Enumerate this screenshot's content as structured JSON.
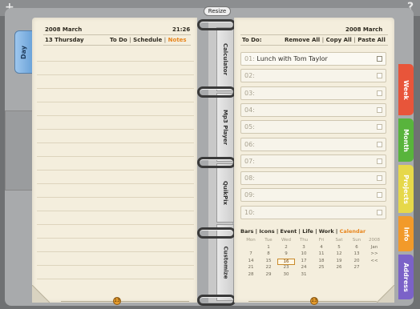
{
  "window": {
    "add_glyph": "+",
    "help_glyph": "?",
    "resize_label": "Resize"
  },
  "left_tab": {
    "label": "Day"
  },
  "left_page": {
    "year_month": "2008 March",
    "time": "21:26",
    "day": "13 Thursday",
    "tabs": [
      "To Do",
      "Schedule",
      "Notes"
    ],
    "active_tab": "Notes",
    "page_number": "13"
  },
  "spine_tabs": [
    "Calculator",
    "Mp3 Player",
    "QuikPix",
    "Customize"
  ],
  "right_page": {
    "year_month": "2008 March",
    "todo_label": "To Do:",
    "actions": [
      "Remove All",
      "Copy All",
      "Paste All"
    ],
    "page_number": "13",
    "todos": [
      {
        "num": "01:",
        "text": "Lunch with Tom Taylor"
      },
      {
        "num": "02:",
        "text": ""
      },
      {
        "num": "03:",
        "text": ""
      },
      {
        "num": "04:",
        "text": ""
      },
      {
        "num": "05:",
        "text": ""
      },
      {
        "num": "06:",
        "text": ""
      },
      {
        "num": "07:",
        "text": ""
      },
      {
        "num": "08:",
        "text": ""
      },
      {
        "num": "09:",
        "text": ""
      },
      {
        "num": "10:",
        "text": ""
      }
    ]
  },
  "calendar": {
    "views": [
      "Bars",
      "Icons",
      "Event",
      "Life",
      "Work",
      "Calendar"
    ],
    "active_view": "Calendar",
    "weekdays": [
      "Mon",
      "Tue",
      "Wed",
      "Thu",
      "Fri",
      "Sat",
      "Sun"
    ],
    "year": "2008",
    "month_abbr": "Jan",
    "next_glyph": ">>",
    "prev_glyph": "<<",
    "weeks": [
      [
        "",
        "1",
        "2",
        "3",
        "4",
        "5",
        "6"
      ],
      [
        "7",
        "8",
        "9",
        "10",
        "11",
        "12",
        "13"
      ],
      [
        "14",
        "15",
        "16",
        "17",
        "18",
        "19",
        "20"
      ],
      [
        "21",
        "22",
        "23",
        "24",
        "25",
        "26",
        "27"
      ],
      [
        "28",
        "29",
        "30",
        "31",
        "",
        "",
        ""
      ]
    ],
    "selected_day": "16"
  },
  "right_tabs": [
    {
      "label": "Week",
      "color": "#e8553a"
    },
    {
      "label": "Month",
      "color": "#58b43c"
    },
    {
      "label": "Projects",
      "color": "#e6d84a"
    },
    {
      "label": "Info",
      "color": "#f29a2a"
    },
    {
      "label": "Address",
      "color": "#7b62c8"
    }
  ]
}
